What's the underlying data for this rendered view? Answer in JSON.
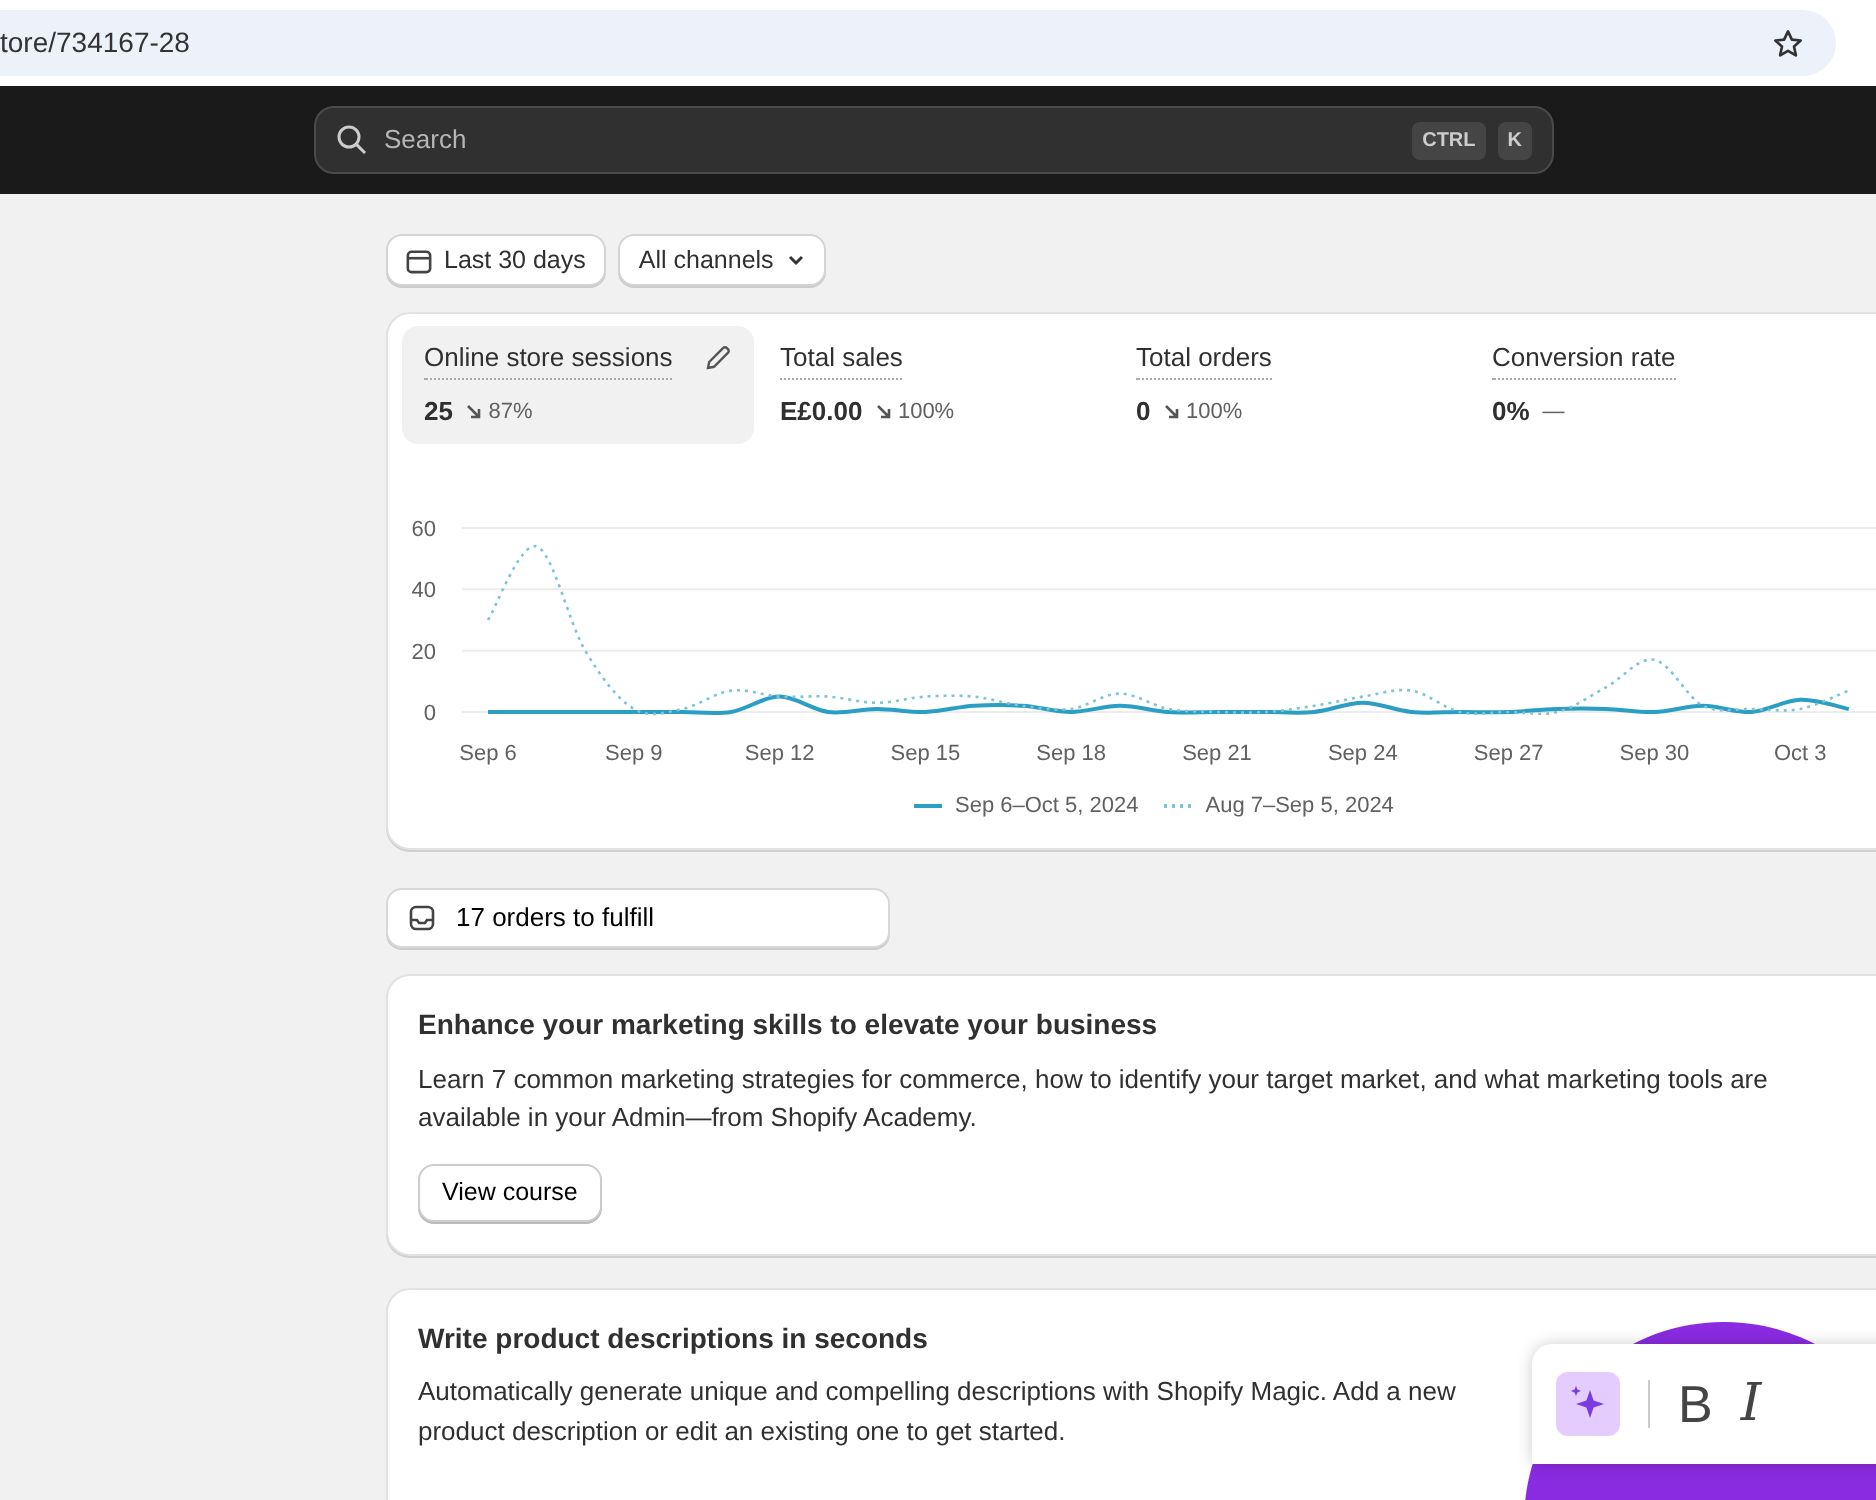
{
  "browser": {
    "url": "tore/734167-28"
  },
  "topbar": {
    "search": {
      "placeholder": "Search",
      "shortcut": [
        "CTRL",
        "K"
      ]
    }
  },
  "filters": [
    {
      "kind": "date",
      "label": "Last 30 days"
    },
    {
      "kind": "dropdown",
      "label": "All channels"
    }
  ],
  "metrics": [
    {
      "kind": "decrease",
      "label": "Online store sessions",
      "value": "25",
      "change": "87%",
      "selected": true
    },
    {
      "kind": "decrease",
      "label": "Total sales",
      "value": "E£0.00",
      "change": "100%",
      "selected": false
    },
    {
      "kind": "decrease",
      "label": "Total orders",
      "value": "0",
      "change": "100%",
      "selected": false
    },
    {
      "kind": "flat",
      "label": "Conversion rate",
      "value": "0%",
      "change": "—",
      "selected": false
    }
  ],
  "chart_data": {
    "type": "line",
    "categories": [
      "Sep 6",
      null,
      null,
      "Sep 9",
      null,
      null,
      "Sep 12",
      null,
      null,
      "Sep 15",
      null,
      null,
      "Sep 18",
      null,
      null,
      "Sep 21",
      null,
      null,
      "Sep 24",
      null,
      null,
      "Sep 27",
      null,
      null,
      "Sep 30",
      null,
      null,
      "Oct 3",
      null
    ],
    "legend": "bottom",
    "ylim": [
      0,
      60
    ],
    "yticks": [
      0,
      20,
      40,
      60
    ],
    "series": [
      {
        "name": "Sep 6–Oct 5, 2024",
        "color": "#2a9ec3",
        "line_style": "solid",
        "values": [
          0,
          0,
          0,
          0,
          0,
          0,
          5,
          0,
          1,
          0,
          2,
          2,
          0,
          2,
          0,
          0,
          0,
          0,
          3,
          0,
          0,
          0,
          1,
          1,
          0,
          2,
          0,
          4,
          1
        ]
      },
      {
        "name": "Aug 7–Sep 5, 2024",
        "color": "#7cc4d8",
        "line_style": "dotted",
        "values": [
          30,
          54,
          20,
          1,
          1,
          7,
          5,
          5,
          3,
          5,
          5,
          2,
          1,
          6,
          1,
          0,
          0,
          2,
          5,
          7,
          0,
          0,
          0,
          8,
          17,
          2,
          1,
          1,
          7
        ]
      }
    ]
  },
  "fulfill": {
    "label": "17 orders to fulfill"
  },
  "cards": [
    {
      "kind": "course",
      "title": "Enhance your marketing skills to elevate your business",
      "body": "Learn 7 common marketing strategies for commerce, how to identify your target market, and what marketing tools are available in your Admin—from Shopify Academy.",
      "button": "View course"
    },
    {
      "kind": "magic",
      "title": "Write product descriptions in seconds",
      "body": "Automatically generate unique and compelling descriptions with Shopify Magic. Add a new product description or edit an existing one to get started.",
      "toolbar": [
        "B",
        "I"
      ]
    }
  ]
}
